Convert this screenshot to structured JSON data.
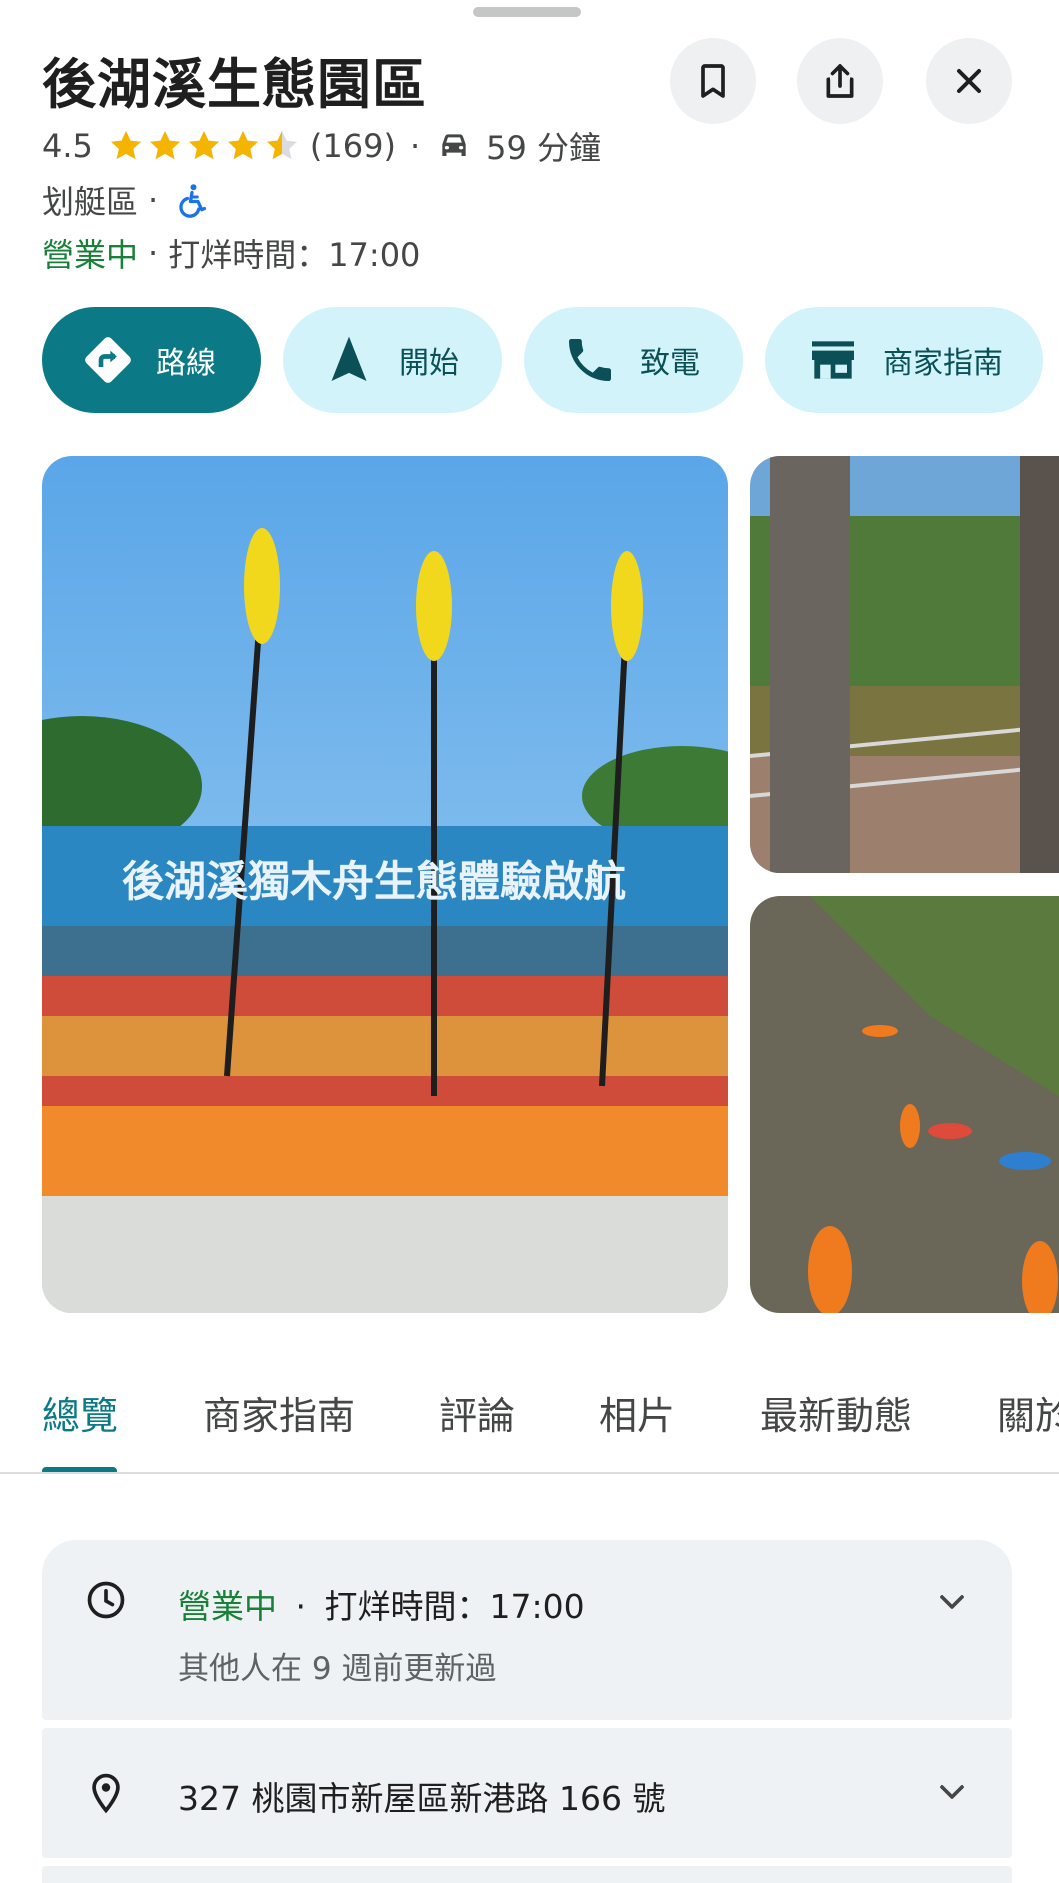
{
  "place": {
    "name": "後湖溪生態園區",
    "rating": "4.5",
    "rating_value": 4.5,
    "review_count": "(169)",
    "drive_time": "59 分鐘",
    "category": "划艇區",
    "status_open": "營業中",
    "status_close": "打烊時間：17:00"
  },
  "header_actions": {
    "save_icon": "bookmark-icon",
    "share_icon": "share-icon",
    "close_icon": "close-icon"
  },
  "actions": [
    {
      "label": "路線",
      "icon": "directions-icon"
    },
    {
      "label": "開始",
      "icon": "navigation-arrow-icon"
    },
    {
      "label": "致電",
      "icon": "phone-icon"
    },
    {
      "label": "商家指南",
      "icon": "storefront-icon"
    }
  ],
  "photos": {
    "main_banner_text": "後湖溪獨木舟生態體驗啟航"
  },
  "tabs": [
    {
      "label": "總覽",
      "active": true
    },
    {
      "label": "商家指南"
    },
    {
      "label": "評論"
    },
    {
      "label": "相片"
    },
    {
      "label": "最新動態"
    },
    {
      "label": "關於"
    }
  ],
  "hours_card": {
    "status_open": "營業中",
    "status_close": "打烊時間：17:00",
    "updated": "其他人在 9 週前更新過"
  },
  "address_card": {
    "address": "327 桃園市新屋區新港路 166 號"
  },
  "colors": {
    "accent": "#0b7a86",
    "chip_bg": "#d3f3fb",
    "open_green": "#188038",
    "star": "#f4b400"
  }
}
